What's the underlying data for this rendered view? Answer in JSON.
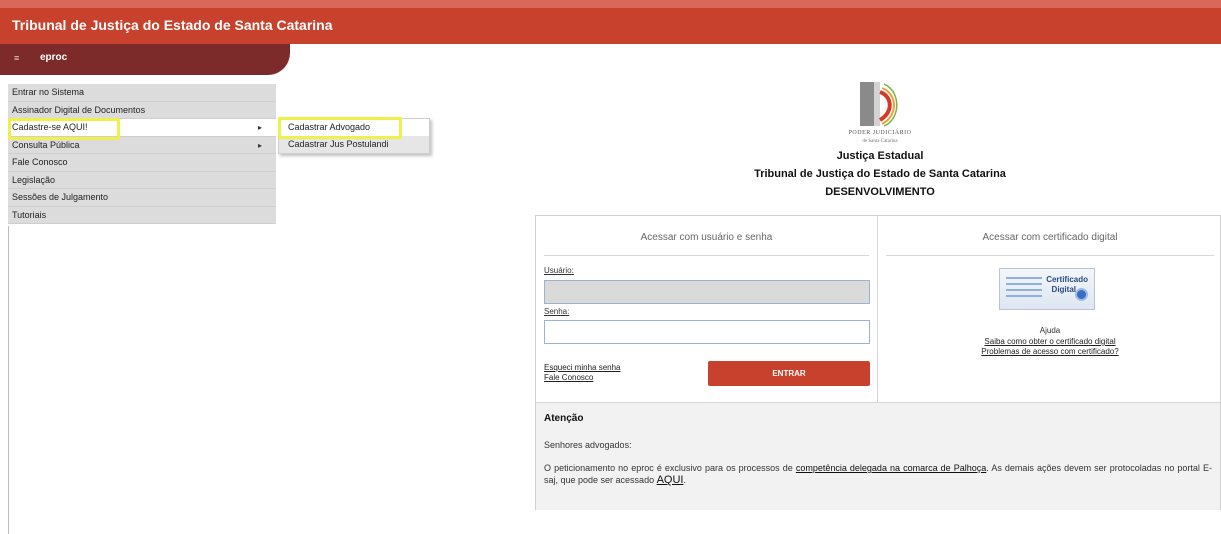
{
  "header": {
    "title": "Tribunal de Justiça do Estado de Santa Catarina"
  },
  "subbar": {
    "icon_text": "≡",
    "label": "eproc"
  },
  "left_menu": [
    {
      "label": "Entrar no Sistema",
      "has_submenu": false
    },
    {
      "label": "Assinador Digital de Documentos",
      "has_submenu": false
    },
    {
      "label": "Cadastre-se AQUI!",
      "has_submenu": true,
      "highlighted": true
    },
    {
      "label": "Consulta Pública",
      "has_submenu": true
    },
    {
      "label": "Fale Conosco",
      "has_submenu": false
    },
    {
      "label": "Legislação",
      "has_submenu": false
    },
    {
      "label": "Sessões de Julgamento",
      "has_submenu": false
    },
    {
      "label": "Tutoriais",
      "has_submenu": false
    }
  ],
  "submenu": [
    {
      "label": "Cadastrar Advogado",
      "highlighted": true
    },
    {
      "label": "Cadastrar Jus Postulandi"
    }
  ],
  "arrow_glyph": "▸",
  "org": {
    "sub1": "PODER JUDICIÁRIO",
    "sub2": "de Santa Catarina",
    "line1": "Justiça Estadual",
    "line2": "Tribunal de Justiça do Estado de Santa Catarina",
    "line3": "DESENVOLVIMENTO"
  },
  "login": {
    "heading": "Acessar com usuário e senha",
    "user_label": "Usuário:",
    "user_value": "",
    "password_label": "Senha:",
    "password_value": "",
    "forgot_link": "Esqueci minha senha",
    "contact_link": "Fale Conosco",
    "submit": "ENTRAR"
  },
  "certificate": {
    "heading": "Acessar com certificado digital",
    "badge_line1": "Certificado",
    "badge_line2": "Digital",
    "help": "Ajuda",
    "link1": "Saiba como obter o certificado digital",
    "link2": "Problemas de acesso com certificado?"
  },
  "attention": {
    "title": "Atenção",
    "p1": "Senhores advogados:",
    "p2_a": "O peticionamento no eproc é exclusivo para os processos de ",
    "p2_link": "competência delegada na comarca de Palhoça",
    "p2_b": ". As demais ações devem ser protocoladas no portal E-saj, que pode ser acessado ",
    "p2_link2": "AQUI",
    "p2_c": "."
  },
  "colors": {
    "brand_red": "#c8412c",
    "dark_red": "#7c2b2a",
    "highlight_yellow": "#f0f04a"
  }
}
